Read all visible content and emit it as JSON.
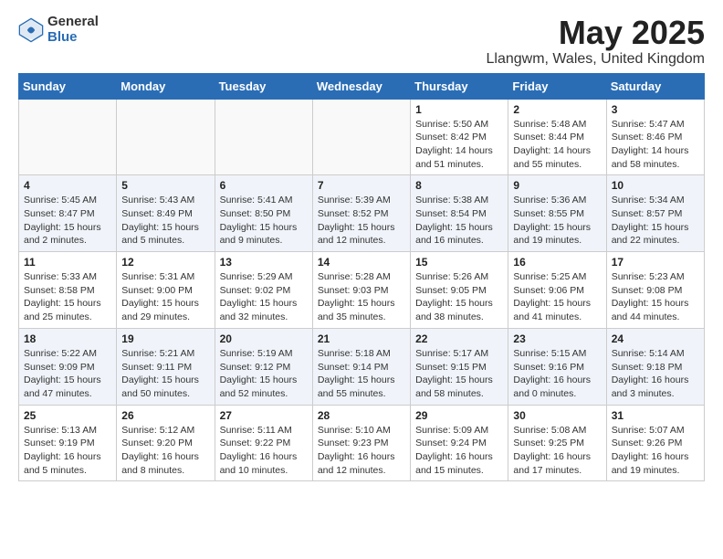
{
  "logo": {
    "general": "General",
    "blue": "Blue"
  },
  "title": "May 2025",
  "location": "Llangwm, Wales, United Kingdom",
  "days_of_week": [
    "Sunday",
    "Monday",
    "Tuesday",
    "Wednesday",
    "Thursday",
    "Friday",
    "Saturday"
  ],
  "weeks": [
    [
      {
        "day": "",
        "info": ""
      },
      {
        "day": "",
        "info": ""
      },
      {
        "day": "",
        "info": ""
      },
      {
        "day": "",
        "info": ""
      },
      {
        "day": "1",
        "info": "Sunrise: 5:50 AM\nSunset: 8:42 PM\nDaylight: 14 hours\nand 51 minutes."
      },
      {
        "day": "2",
        "info": "Sunrise: 5:48 AM\nSunset: 8:44 PM\nDaylight: 14 hours\nand 55 minutes."
      },
      {
        "day": "3",
        "info": "Sunrise: 5:47 AM\nSunset: 8:46 PM\nDaylight: 14 hours\nand 58 minutes."
      }
    ],
    [
      {
        "day": "4",
        "info": "Sunrise: 5:45 AM\nSunset: 8:47 PM\nDaylight: 15 hours\nand 2 minutes."
      },
      {
        "day": "5",
        "info": "Sunrise: 5:43 AM\nSunset: 8:49 PM\nDaylight: 15 hours\nand 5 minutes."
      },
      {
        "day": "6",
        "info": "Sunrise: 5:41 AM\nSunset: 8:50 PM\nDaylight: 15 hours\nand 9 minutes."
      },
      {
        "day": "7",
        "info": "Sunrise: 5:39 AM\nSunset: 8:52 PM\nDaylight: 15 hours\nand 12 minutes."
      },
      {
        "day": "8",
        "info": "Sunrise: 5:38 AM\nSunset: 8:54 PM\nDaylight: 15 hours\nand 16 minutes."
      },
      {
        "day": "9",
        "info": "Sunrise: 5:36 AM\nSunset: 8:55 PM\nDaylight: 15 hours\nand 19 minutes."
      },
      {
        "day": "10",
        "info": "Sunrise: 5:34 AM\nSunset: 8:57 PM\nDaylight: 15 hours\nand 22 minutes."
      }
    ],
    [
      {
        "day": "11",
        "info": "Sunrise: 5:33 AM\nSunset: 8:58 PM\nDaylight: 15 hours\nand 25 minutes."
      },
      {
        "day": "12",
        "info": "Sunrise: 5:31 AM\nSunset: 9:00 PM\nDaylight: 15 hours\nand 29 minutes."
      },
      {
        "day": "13",
        "info": "Sunrise: 5:29 AM\nSunset: 9:02 PM\nDaylight: 15 hours\nand 32 minutes."
      },
      {
        "day": "14",
        "info": "Sunrise: 5:28 AM\nSunset: 9:03 PM\nDaylight: 15 hours\nand 35 minutes."
      },
      {
        "day": "15",
        "info": "Sunrise: 5:26 AM\nSunset: 9:05 PM\nDaylight: 15 hours\nand 38 minutes."
      },
      {
        "day": "16",
        "info": "Sunrise: 5:25 AM\nSunset: 9:06 PM\nDaylight: 15 hours\nand 41 minutes."
      },
      {
        "day": "17",
        "info": "Sunrise: 5:23 AM\nSunset: 9:08 PM\nDaylight: 15 hours\nand 44 minutes."
      }
    ],
    [
      {
        "day": "18",
        "info": "Sunrise: 5:22 AM\nSunset: 9:09 PM\nDaylight: 15 hours\nand 47 minutes."
      },
      {
        "day": "19",
        "info": "Sunrise: 5:21 AM\nSunset: 9:11 PM\nDaylight: 15 hours\nand 50 minutes."
      },
      {
        "day": "20",
        "info": "Sunrise: 5:19 AM\nSunset: 9:12 PM\nDaylight: 15 hours\nand 52 minutes."
      },
      {
        "day": "21",
        "info": "Sunrise: 5:18 AM\nSunset: 9:14 PM\nDaylight: 15 hours\nand 55 minutes."
      },
      {
        "day": "22",
        "info": "Sunrise: 5:17 AM\nSunset: 9:15 PM\nDaylight: 15 hours\nand 58 minutes."
      },
      {
        "day": "23",
        "info": "Sunrise: 5:15 AM\nSunset: 9:16 PM\nDaylight: 16 hours\nand 0 minutes."
      },
      {
        "day": "24",
        "info": "Sunrise: 5:14 AM\nSunset: 9:18 PM\nDaylight: 16 hours\nand 3 minutes."
      }
    ],
    [
      {
        "day": "25",
        "info": "Sunrise: 5:13 AM\nSunset: 9:19 PM\nDaylight: 16 hours\nand 5 minutes."
      },
      {
        "day": "26",
        "info": "Sunrise: 5:12 AM\nSunset: 9:20 PM\nDaylight: 16 hours\nand 8 minutes."
      },
      {
        "day": "27",
        "info": "Sunrise: 5:11 AM\nSunset: 9:22 PM\nDaylight: 16 hours\nand 10 minutes."
      },
      {
        "day": "28",
        "info": "Sunrise: 5:10 AM\nSunset: 9:23 PM\nDaylight: 16 hours\nand 12 minutes."
      },
      {
        "day": "29",
        "info": "Sunrise: 5:09 AM\nSunset: 9:24 PM\nDaylight: 16 hours\nand 15 minutes."
      },
      {
        "day": "30",
        "info": "Sunrise: 5:08 AM\nSunset: 9:25 PM\nDaylight: 16 hours\nand 17 minutes."
      },
      {
        "day": "31",
        "info": "Sunrise: 5:07 AM\nSunset: 9:26 PM\nDaylight: 16 hours\nand 19 minutes."
      }
    ]
  ]
}
